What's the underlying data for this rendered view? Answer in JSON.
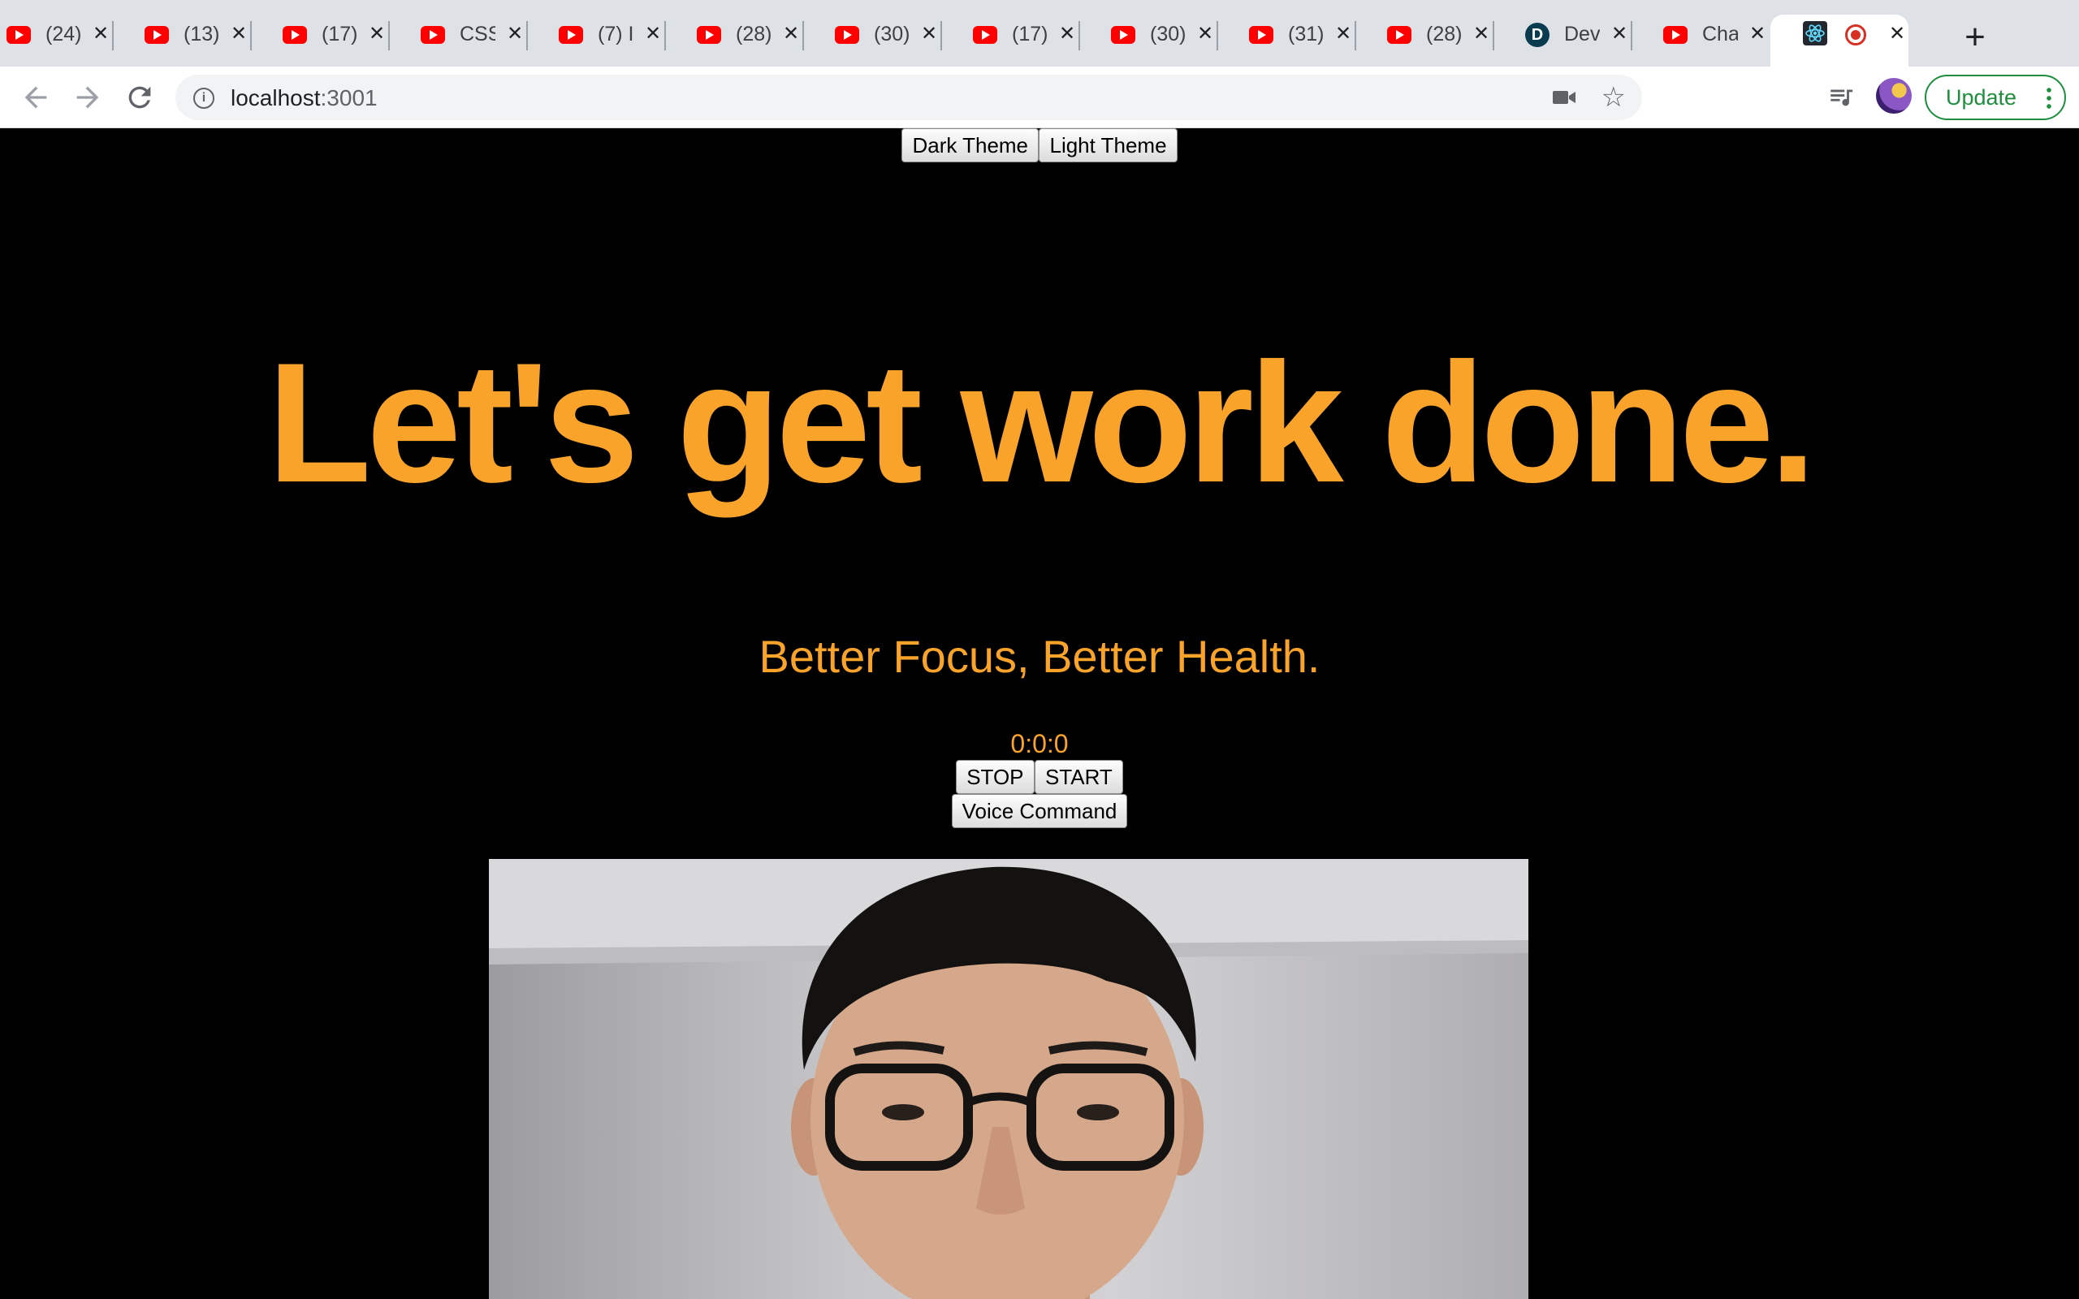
{
  "browser": {
    "tabs": [
      {
        "icon": "youtube-icon",
        "title": "(24)"
      },
      {
        "icon": "youtube-icon",
        "title": "(13)"
      },
      {
        "icon": "youtube-icon",
        "title": "(17)"
      },
      {
        "icon": "youtube-icon",
        "title": "CSS"
      },
      {
        "icon": "youtube-icon",
        "title": "(7) I"
      },
      {
        "icon": "youtube-icon",
        "title": "(28)"
      },
      {
        "icon": "youtube-icon",
        "title": "(30)"
      },
      {
        "icon": "youtube-icon",
        "title": "(17)"
      },
      {
        "icon": "youtube-icon",
        "title": "(30)"
      },
      {
        "icon": "youtube-icon",
        "title": "(31)"
      },
      {
        "icon": "youtube-icon",
        "title": "(28)"
      },
      {
        "icon": "dev-icon",
        "title": "Dev"
      },
      {
        "icon": "youtube-icon",
        "title": "Cha"
      },
      {
        "icon": "react-icon",
        "title": "",
        "active": true,
        "recording": true
      }
    ],
    "url_host": "localhost",
    "url_port": ":3001",
    "update_label": "Update",
    "colors": {
      "accent_green": "#1e8e3e",
      "tab_strip": "#dee1e6"
    }
  },
  "app": {
    "theme_buttons": {
      "dark": "Dark Theme",
      "light": "Light Theme"
    },
    "headline": "Let's get work done.",
    "subtitle": "Better Focus, Better Health.",
    "timer": "0:0:0",
    "controls": {
      "stop": "STOP",
      "start": "START",
      "voice": "Voice Command"
    },
    "colors": {
      "accent": "#f9a32a",
      "background": "#000000"
    }
  }
}
